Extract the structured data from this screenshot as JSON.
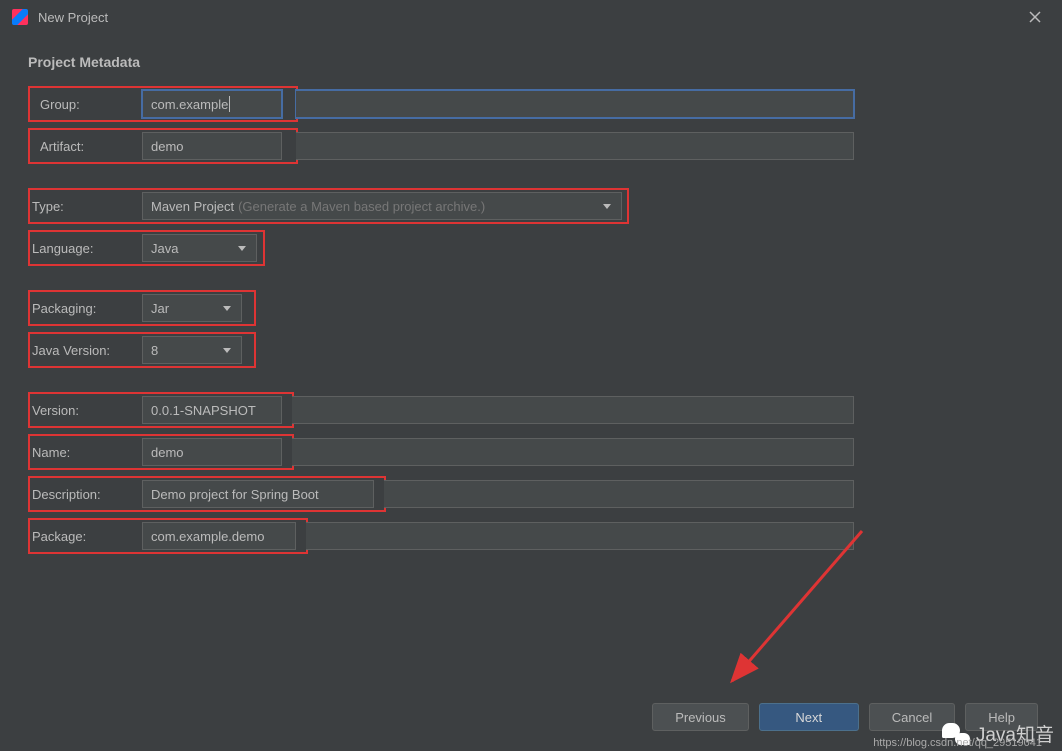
{
  "window": {
    "title": "New Project"
  },
  "section": {
    "title": "Project Metadata"
  },
  "fields": {
    "group": {
      "label": "Group:",
      "value": "com.example"
    },
    "artifact": {
      "label": "Artifact:",
      "value": "demo"
    },
    "type": {
      "label": "Type:",
      "value": "Maven Project",
      "hint": "(Generate a Maven based project archive.)"
    },
    "language": {
      "label": "Language:",
      "value": "Java"
    },
    "packaging": {
      "label": "Packaging:",
      "value": "Jar"
    },
    "javaVersion": {
      "label": "Java Version:",
      "value": "8"
    },
    "version": {
      "label": "Version:",
      "value": "0.0.1-SNAPSHOT"
    },
    "name": {
      "label": "Name:",
      "value": "demo"
    },
    "description": {
      "label": "Description:",
      "value": "Demo project for Spring Boot"
    },
    "package": {
      "label": "Package:",
      "value": "com.example.demo"
    }
  },
  "buttons": {
    "previous": "Previous",
    "next": "Next",
    "cancel": "Cancel",
    "help": "Help"
  },
  "annotations": {
    "highlight_color": "#de3434"
  },
  "watermark": {
    "text": "Java知音",
    "url": "https://blog.csdn.net/qq_29519041"
  }
}
